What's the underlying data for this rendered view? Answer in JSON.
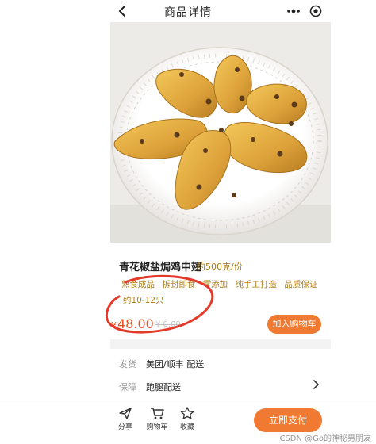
{
  "navbar": {
    "title": "商品详情",
    "back_icon": "chevron-left-icon",
    "more_icon": "more-dots-icon",
    "target_icon": "target-icon"
  },
  "product": {
    "image": "food-photo",
    "title": "青花椒盐焗鸡中翅",
    "spec": "约500克/份",
    "tags": [
      "熟食成品",
      "拆封即食",
      "零添加",
      "纯手工打造",
      "品质保证"
    ],
    "count": "约10-12只",
    "price_symbol": "¥",
    "price": "48.00",
    "price_original": "¥ 0.00",
    "cart_button": "加入购物车"
  },
  "delivery": {
    "rows": [
      {
        "label": "发货",
        "value": "美团/顺丰 配送"
      },
      {
        "label": "保障",
        "value": "跑腿配送"
      }
    ]
  },
  "bottom_bar": {
    "items": [
      {
        "label": "分享",
        "icon": "share-icon"
      },
      {
        "label": "购物车",
        "icon": "cart-icon"
      },
      {
        "label": "收藏",
        "icon": "star-icon"
      }
    ],
    "buy_button": "立即支付"
  },
  "watermark": "CSDN @Go的神秘男朋友",
  "colors": {
    "accent": "#f07a32",
    "price": "#e8502a",
    "tag": "#b07c14",
    "annotation": "#e53a2a"
  }
}
